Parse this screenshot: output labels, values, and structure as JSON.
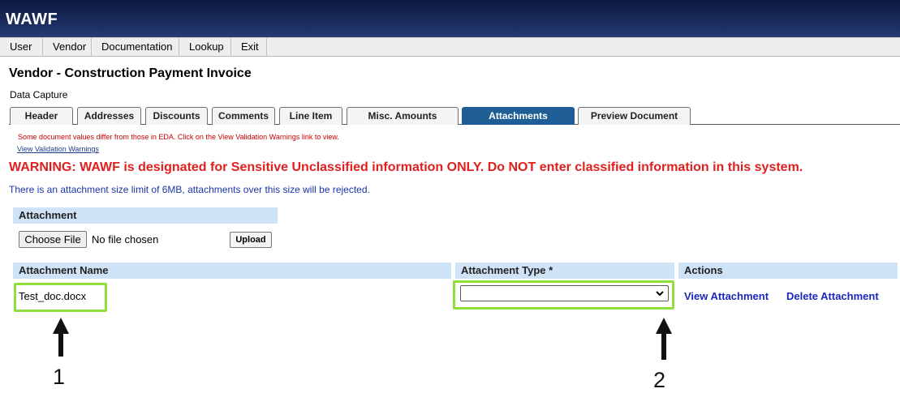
{
  "app": {
    "title": "WAWF"
  },
  "menu": {
    "items": [
      {
        "label": "User"
      },
      {
        "label": "Vendor"
      },
      {
        "label": "Documentation"
      },
      {
        "label": "Lookup"
      },
      {
        "label": "Exit"
      }
    ]
  },
  "page": {
    "title": "Vendor - Construction Payment Invoice",
    "subtitle": "Data Capture"
  },
  "tabs": [
    {
      "label": "Header"
    },
    {
      "label": "Addresses"
    },
    {
      "label": "Discounts"
    },
    {
      "label": "Comments"
    },
    {
      "label": "Line Item"
    },
    {
      "label": "Misc. Amounts"
    },
    {
      "label": "Attachments",
      "active": true
    },
    {
      "label": "Preview Document"
    }
  ],
  "messages": {
    "eda": "Some document values differ from those in EDA. Click on the View Validation Warnings link to view.",
    "validation_link": "View Validation Warnings",
    "warning": "WARNING: WAWF is designated for Sensitive Unclassified information ONLY. Do NOT enter classified information in this system.",
    "size_limit": "There is an attachment size limit of 6MB, attachments over this size will be rejected."
  },
  "upload": {
    "header": "Attachment",
    "choose_label": "Choose File",
    "no_file": "No file chosen",
    "upload_label": "Upload"
  },
  "table": {
    "col_name": "Attachment Name",
    "col_type": "Attachment Type *",
    "col_actions": "Actions",
    "rows": [
      {
        "name": "Test_doc.docx",
        "type": "",
        "view": "View Attachment",
        "delete": "Delete Attachment"
      }
    ]
  },
  "annotations": {
    "label_1": "1",
    "label_2": "2"
  },
  "colors": {
    "banner": "#1c2f62",
    "active_tab": "#1f5e94",
    "section_header": "#cfe3f7",
    "warning": "#e0201f",
    "highlight": "#8fe03b",
    "link": "#1b27b8"
  }
}
